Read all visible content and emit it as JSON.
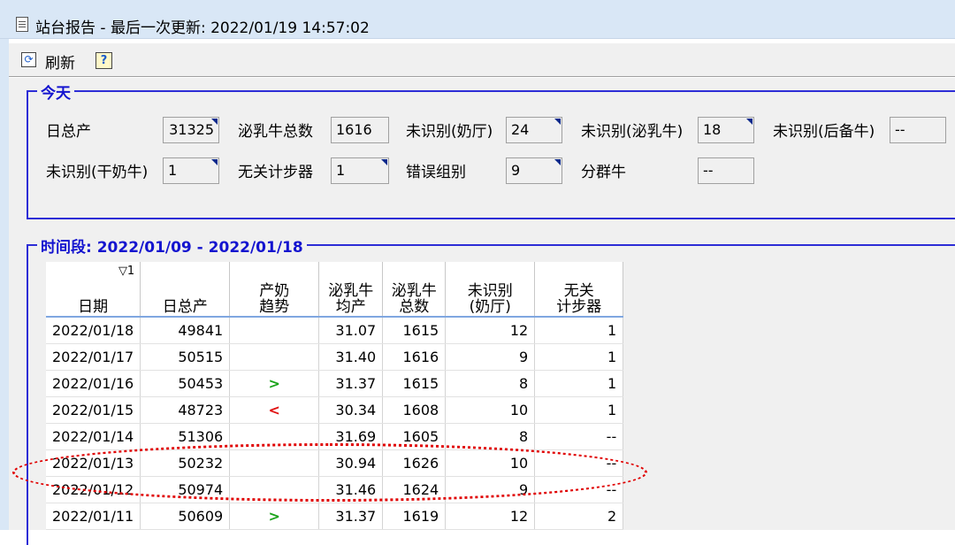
{
  "window": {
    "title": "站台报告 - 最后一次更新: 2022/01/19 14:57:02"
  },
  "toolbar": {
    "refresh_label": "刷新",
    "refresh_glyph": "⟳",
    "help_glyph": "?"
  },
  "today": {
    "title": "今天",
    "fields": {
      "total_yield": {
        "label": "日总产",
        "value": "31325"
      },
      "lactating": {
        "label": "泌乳牛总数",
        "value": "1616"
      },
      "unid_parlor": {
        "label": "未识别(奶厅)",
        "value": "24"
      },
      "unid_lact": {
        "label": "未识别(泌乳牛)",
        "value": "18"
      },
      "unid_heifer": {
        "label": "未识别(后备牛)",
        "value": "--"
      },
      "unid_dry": {
        "label": "未识别(干奶牛)",
        "value": "1"
      },
      "no_pedometer": {
        "label": "无关计步器",
        "value": "1"
      },
      "wrong_group": {
        "label": "错误组别",
        "value": "9"
      },
      "separate_cow": {
        "label": "分群牛",
        "value": "--"
      }
    }
  },
  "period": {
    "title": "时间段: 2022/01/09 - 2022/01/18",
    "sort_indicator": "▽1",
    "columns": [
      "日期",
      "日总产",
      "产奶\n趋势",
      "泌乳牛\n均产",
      "泌乳牛\n总数",
      "未识别\n(奶厅)",
      "无关\n计步器"
    ],
    "rows": [
      {
        "date": "2022/01/18",
        "total": "49841",
        "trend": "",
        "avg": "31.07",
        "count": "1615",
        "unid": "12",
        "noped": "1"
      },
      {
        "date": "2022/01/17",
        "total": "50515",
        "trend": "",
        "avg": "31.40",
        "count": "1616",
        "unid": "9",
        "noped": "1"
      },
      {
        "date": "2022/01/16",
        "total": "50453",
        "trend": ">",
        "avg": "31.37",
        "count": "1615",
        "unid": "8",
        "noped": "1"
      },
      {
        "date": "2022/01/15",
        "total": "48723",
        "trend": "<",
        "avg": "30.34",
        "count": "1608",
        "unid": "10",
        "noped": "1"
      },
      {
        "date": "2022/01/14",
        "total": "51306",
        "trend": "",
        "avg": "31.69",
        "count": "1605",
        "unid": "8",
        "noped": "--"
      },
      {
        "date": "2022/01/13",
        "total": "50232",
        "trend": "",
        "avg": "30.94",
        "count": "1626",
        "unid": "10",
        "noped": "--"
      },
      {
        "date": "2022/01/12",
        "total": "50974",
        "trend": "",
        "avg": "31.46",
        "count": "1624",
        "unid": "9",
        "noped": "--"
      },
      {
        "date": "2022/01/11",
        "total": "50609",
        "trend": ">",
        "avg": "31.37",
        "count": "1619",
        "unid": "12",
        "noped": "2"
      }
    ]
  },
  "colors": {
    "group_border": "#2d2dd6",
    "group_title": "#1414cf",
    "trend_up": "#1aa31a",
    "trend_down": "#e01010",
    "highlight_oval": "#e00000"
  }
}
